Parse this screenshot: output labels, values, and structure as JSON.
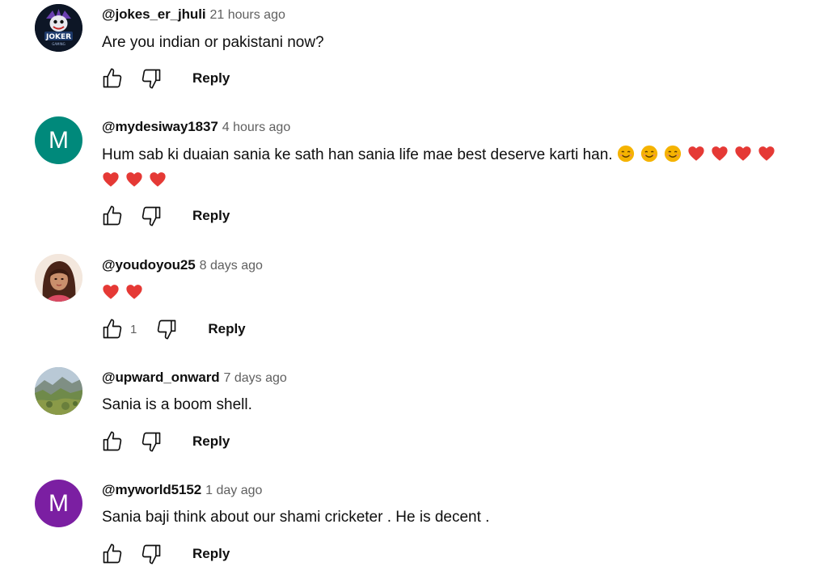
{
  "comments": [
    {
      "handle": "@jokes_er_jhuli",
      "time": "21 hours ago",
      "text": "Are you indian or pakistani now?",
      "avatar": {
        "type": "image",
        "label": "JOKER",
        "sublabel": "GAMING",
        "icon": "joker-avatar"
      },
      "likes": "",
      "reply_label": "Reply"
    },
    {
      "handle": "@mydesiway1837",
      "time": "4 hours ago",
      "text": "Hum sab ki duaian sania ke sath han sania life mae best deserve karti han.",
      "emojis_line1": [
        "smile",
        "smile",
        "smile",
        "heart",
        "heart",
        "heart",
        "heart"
      ],
      "emojis_line2": [
        "heart",
        "heart",
        "heart"
      ],
      "avatar": {
        "type": "letter",
        "letter": "M",
        "color": "#00897b"
      },
      "likes": "",
      "reply_label": "Reply"
    },
    {
      "handle": "@youdoyou25",
      "time": "8 days ago",
      "text": "",
      "emojis_line1": [
        "heart",
        "heart"
      ],
      "avatar": {
        "type": "image",
        "icon": "woman-illustration-avatar"
      },
      "likes": "1",
      "reply_label": "Reply"
    },
    {
      "handle": "@upward_onward",
      "time": "7 days ago",
      "text": "Sania is a boom shell.",
      "avatar": {
        "type": "image",
        "icon": "mountain-landscape-avatar"
      },
      "likes": "",
      "reply_label": "Reply"
    },
    {
      "handle": "@myworld5152",
      "time": "1 day ago",
      "text": "Sania baji think about our shami cricketer . He is decent .",
      "avatar": {
        "type": "letter",
        "letter": "M",
        "color": "#7b1fa2"
      },
      "likes": "",
      "reply_label": "Reply"
    }
  ],
  "colors": {
    "text": "#0f0f0f",
    "secondary": "#606060",
    "heart": "#e53935",
    "smile": "#f5b300"
  }
}
